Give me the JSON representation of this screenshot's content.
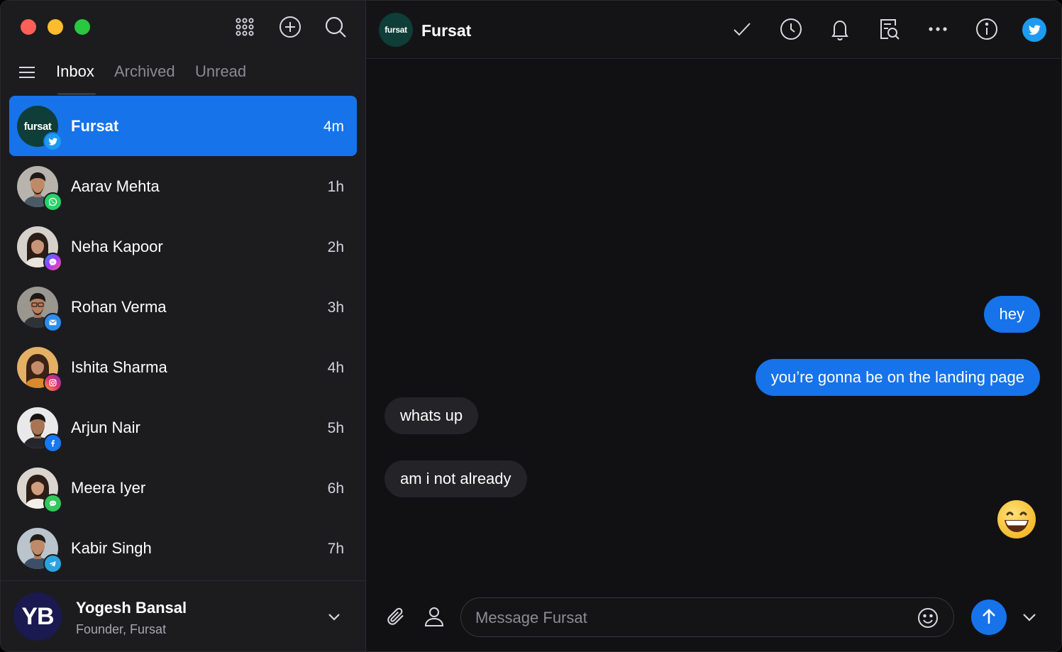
{
  "window": {
    "title": "Fursat"
  },
  "sidebar": {
    "tabs": [
      {
        "label": "Inbox",
        "active": true
      },
      {
        "label": "Archived",
        "active": false
      },
      {
        "label": "Unread",
        "active": false
      }
    ],
    "conversations": [
      {
        "name": "Fursat",
        "time": "4m",
        "avatar_text": "fursat",
        "channel": "twitter-icon",
        "active": true
      },
      {
        "name": "Aarav Mehta",
        "time": "1h",
        "channel": "whatsapp-icon",
        "active": false
      },
      {
        "name": "Neha Kapoor",
        "time": "2h",
        "channel": "messenger-icon",
        "active": false
      },
      {
        "name": "Rohan Verma",
        "time": "3h",
        "channel": "email-icon",
        "active": false
      },
      {
        "name": "Ishita Sharma",
        "time": "4h",
        "channel": "instagram-icon",
        "active": false
      },
      {
        "name": "Arjun Nair",
        "time": "5h",
        "channel": "facebook-icon",
        "active": false
      },
      {
        "name": "Meera Iyer",
        "time": "6h",
        "channel": "imessage-icon",
        "active": false
      },
      {
        "name": "Kabir Singh",
        "time": "7h",
        "channel": "telegram-icon",
        "active": false
      }
    ],
    "profile": {
      "initials": "YB",
      "name": "Yogesh Bansal",
      "role": "Founder, Fursat"
    }
  },
  "chat": {
    "header": {
      "avatar_text": "fursat",
      "title": "Fursat"
    },
    "messages": [
      {
        "direction": "out",
        "text": "hey"
      },
      {
        "direction": "out",
        "text": "you’re gonna be on the landing page"
      },
      {
        "direction": "in",
        "text": "whats up"
      },
      {
        "direction": "in",
        "text": "am i not already"
      },
      {
        "direction": "out",
        "emoji": "grinning-face"
      }
    ],
    "composer": {
      "placeholder": "Message Fursat"
    }
  },
  "colors": {
    "accent": "#1673ea",
    "twitter": "#1d9bf0",
    "whatsapp": "#25d366",
    "sidebar_bg": "#1c1c1f",
    "chat_bg": "#111113",
    "incoming_bubble": "#242428"
  }
}
